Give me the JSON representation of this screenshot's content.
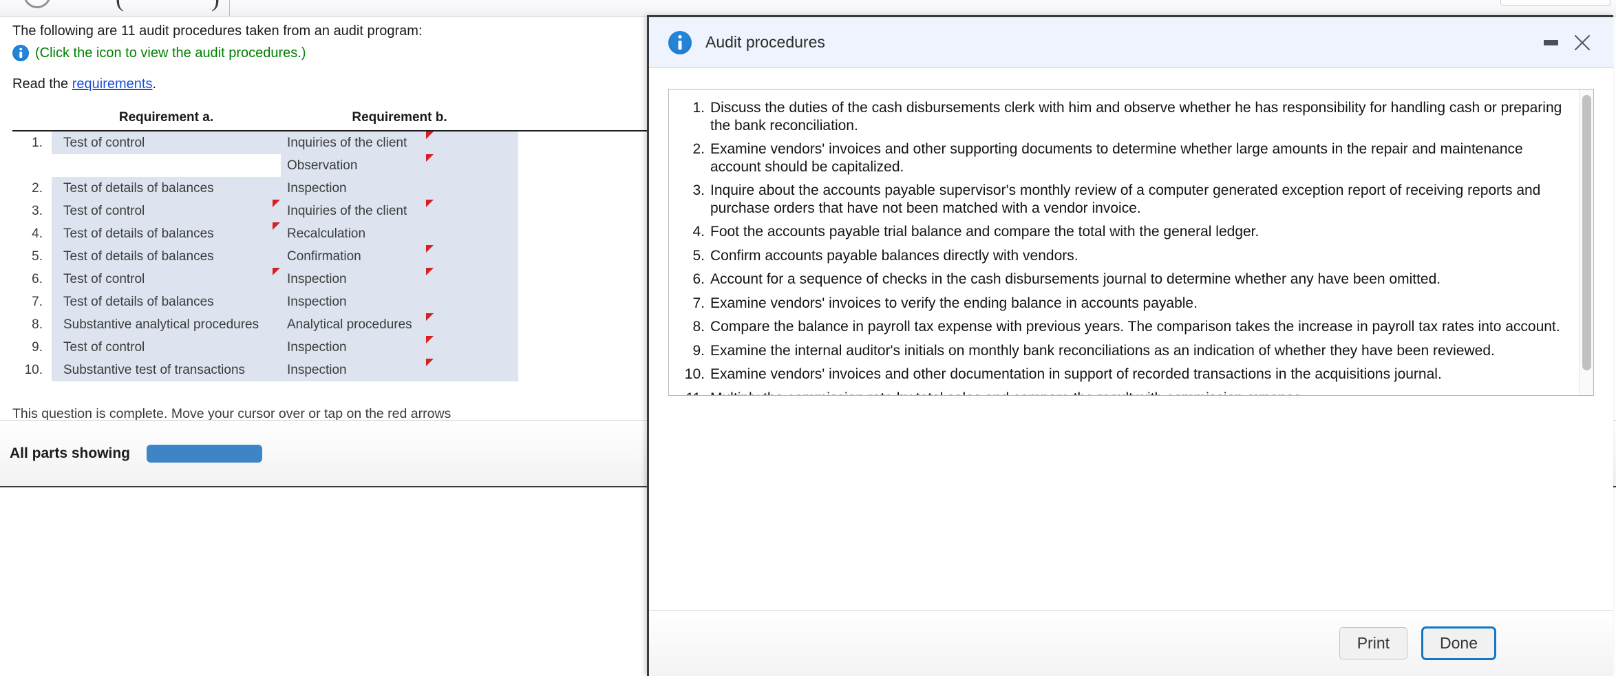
{
  "toolbar": {
    "left_paren": "(",
    "right_paren": ")"
  },
  "question": {
    "intro": "The following are 11 audit procedures taken from an audit program:",
    "icon_hint": "(Click the icon to view the audit procedures.)",
    "read_prefix": "Read the ",
    "read_link": "requirements",
    "read_suffix": ".",
    "completion_note": "This question is complete. Move your cursor over or tap on the red arrows"
  },
  "table": {
    "headers": {
      "num": "",
      "req_a": "Requirement a.",
      "req_b": "Requirement b."
    },
    "rows": [
      {
        "num": "1.",
        "a": "Test of control",
        "b": "Inquiries of the client",
        "mark_a": false,
        "mark_b": true
      },
      {
        "num": "",
        "a": "",
        "b": "Observation",
        "mark_a": false,
        "mark_b": true
      },
      {
        "num": "2.",
        "a": "Test of details of balances",
        "b": "Inspection",
        "mark_a": false,
        "mark_b": false
      },
      {
        "num": "3.",
        "a": "Test of control",
        "b": "Inquiries of the client",
        "mark_a": true,
        "mark_b": true
      },
      {
        "num": "4.",
        "a": "Test of details of balances",
        "b": "Recalculation",
        "mark_a": true,
        "mark_b": false
      },
      {
        "num": "5.",
        "a": "Test of details of balances",
        "b": "Confirmation",
        "mark_a": false,
        "mark_b": true
      },
      {
        "num": "6.",
        "a": "Test of control",
        "b": "Inspection",
        "mark_a": true,
        "mark_b": true
      },
      {
        "num": "7.",
        "a": "Test of details of balances",
        "b": "Inspection",
        "mark_a": false,
        "mark_b": false
      },
      {
        "num": "8.",
        "a": "Substantive analytical procedures",
        "b": "Analytical procedures",
        "mark_a": false,
        "mark_b": true
      },
      {
        "num": "9.",
        "a": "Test of control",
        "b": "Inspection",
        "mark_a": false,
        "mark_b": true
      },
      {
        "num": "10.",
        "a": "Substantive test of transactions",
        "b": "Inspection",
        "mark_a": false,
        "mark_b": true
      }
    ]
  },
  "footer": {
    "status_label": "All parts showing",
    "progress_percent": 100
  },
  "modal": {
    "title": "Audit procedures",
    "minimize_label": "Minimize",
    "close_label": "Close",
    "procedures": [
      "Discuss the duties of the cash disbursements clerk with him and observe whether he has responsibility for handling cash or preparing the bank reconciliation.",
      "Examine vendors' invoices and other supporting documents to determine whether large amounts in the repair and maintenance account should be capitalized.",
      "Inquire about the accounts payable supervisor's monthly review of a computer generated exception report of receiving reports and purchase orders that have not been matched with a vendor invoice.",
      "Foot the accounts payable trial balance and compare the total with the general ledger.",
      "Confirm accounts payable balances directly with vendors.",
      "Account for a sequence of checks in the cash disbursements journal to determine whether any have been omitted.",
      "Examine vendors' invoices to verify the ending balance in accounts payable.",
      "Compare the balance in payroll tax expense with previous years. The comparison takes the increase in payroll tax rates into account.",
      "Examine the internal auditor's initials on monthly bank reconciliations as an indication of whether they have been reviewed.",
      "Examine vendors' invoices and other documentation in support of recorded transactions in the acquisitions journal.",
      "Multiply the commission rate by total sales and compare the result with commission expense."
    ],
    "print_label": "Print",
    "done_label": "Done"
  },
  "colors": {
    "accent_blue": "#2384d8",
    "link_blue": "#1a4fd6",
    "green_hint": "#008000",
    "marker_red": "#d91f22",
    "row_fill": "#dde4f0",
    "progress_blue": "#3d85c6",
    "focus_ring": "#1577c4"
  }
}
